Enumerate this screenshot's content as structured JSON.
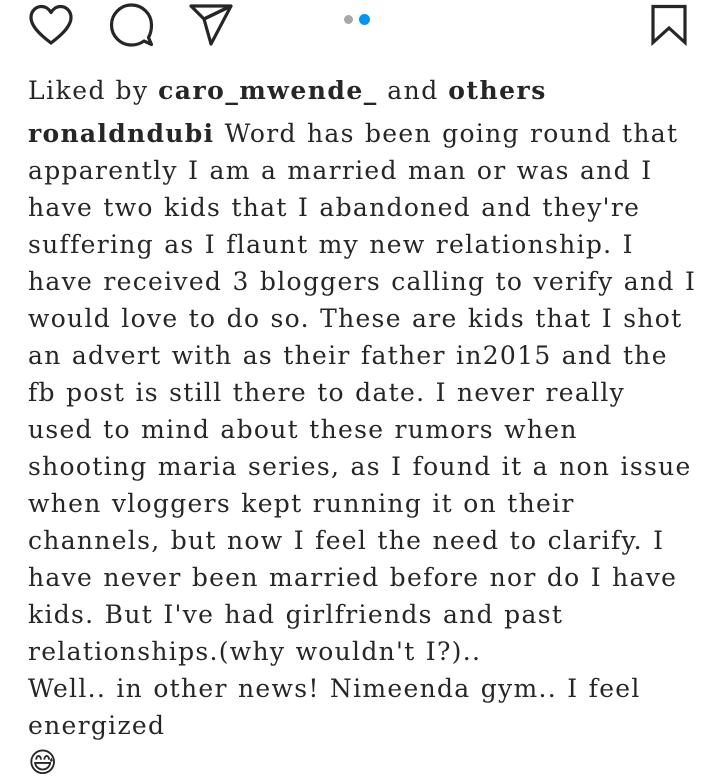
{
  "actions": {
    "like_icon": "heart-outline-icon",
    "comment_icon": "comment-bubble-icon",
    "share_icon": "paper-plane-icon",
    "save_icon": "bookmark-icon"
  },
  "carousel": {
    "total": 2,
    "active_index": 2,
    "active_color": "#0095f6",
    "inactive_color": "#a8a8a8"
  },
  "likes": {
    "prefix": "Liked by",
    "user": "caro_mwende_",
    "connector": "and",
    "others": "others"
  },
  "post": {
    "username": "ronaldndubi",
    "caption_part1": "Word has been going round that apparently I am a married man or was and I have two kids that I abandoned and they're suffering as I flaunt my new relationship. I have received 3 bloggers calling to verify and I would love to do so. These are kids that I shot an advert with as their father in2015 and the fb post is still there to date. I never really used to mind about these rumors when shooting maria series, as I found it a non issue when vloggers kept running it on their channels, but now I feel the need to clarify. I have never been married before nor do I have kids. But I've had girlfriends and past relationships.(why wouldn't I?)..",
    "caption_part2": "Well.. in other news! Nimeenda gym.. I feel energized",
    "emoji": "😅"
  }
}
